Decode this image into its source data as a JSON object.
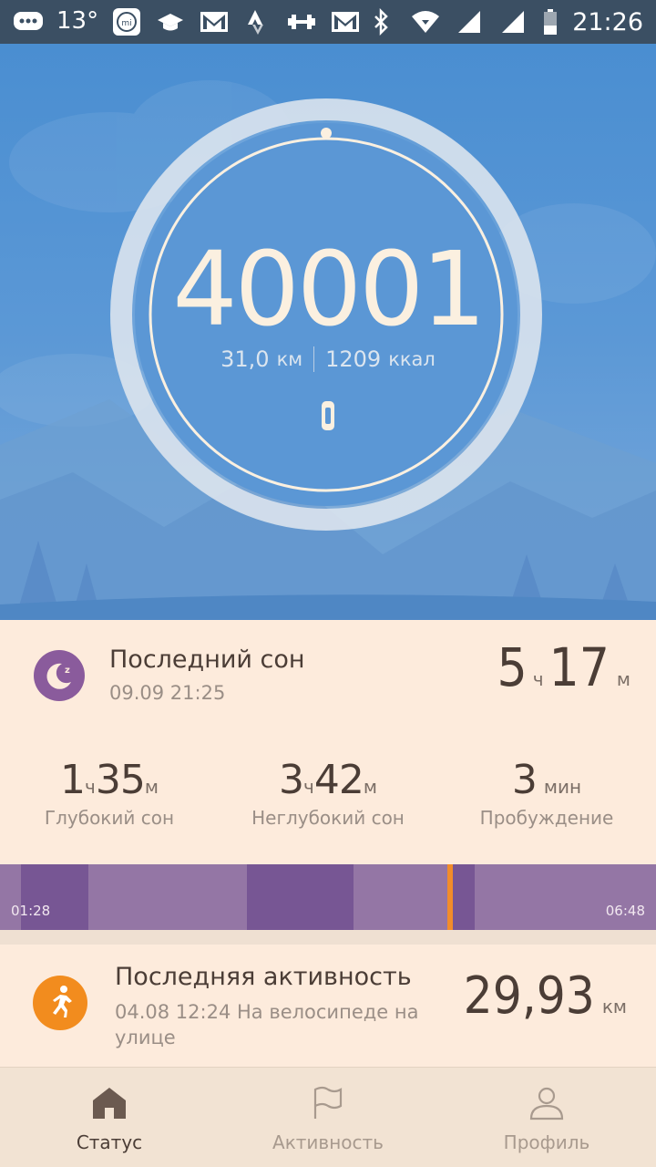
{
  "status_bar": {
    "temperature": "13°",
    "time": "21:26",
    "icons": [
      "chat-bubble-icon",
      "mi-icon",
      "graduation-cap-icon",
      "gmail-icon",
      "strava-icon",
      "dumbbell-icon",
      "gmail-icon",
      "bluetooth-icon",
      "wifi-icon",
      "signal-icon",
      "signal-icon",
      "battery-icon"
    ]
  },
  "steps": {
    "count": "40001",
    "distance_value": "31,0",
    "distance_unit": "км",
    "calories_value": "1209",
    "calories_unit": "ккал",
    "device_icon": "band-icon"
  },
  "sleep": {
    "title": "Последний сон",
    "date": "09.09 21:25",
    "total_hours": "5",
    "hours_unit": "ч",
    "total_minutes": "17",
    "minutes_unit": "м",
    "metrics": [
      {
        "h": "1",
        "hu": "ч",
        "m": "35",
        "mu": "м",
        "label": "Глубокий сон"
      },
      {
        "h": "3",
        "hu": "ч",
        "m": "42",
        "mu": "м",
        "label": "Неглубокий сон"
      },
      {
        "m": "3",
        "mu": "мин",
        "label": "Пробуждение"
      }
    ],
    "bar_start": "01:28",
    "bar_end": "06:48",
    "colors": {
      "light": "#9476a5",
      "deep": "#775694",
      "awake": "#f28c2b",
      "icon": "#8a5b9c"
    }
  },
  "activity": {
    "title": "Последняя активность",
    "detail": "04.08 12:24 На велосипеде на улице",
    "detail_line1": "04.08 12:24 На велосипеде на",
    "detail_line2": "улице",
    "distance": "29,93",
    "unit": "км",
    "icon_color": "#f28c1e"
  },
  "nav": {
    "status": "Статус",
    "activity": "Активность",
    "profile": "Профиль"
  }
}
